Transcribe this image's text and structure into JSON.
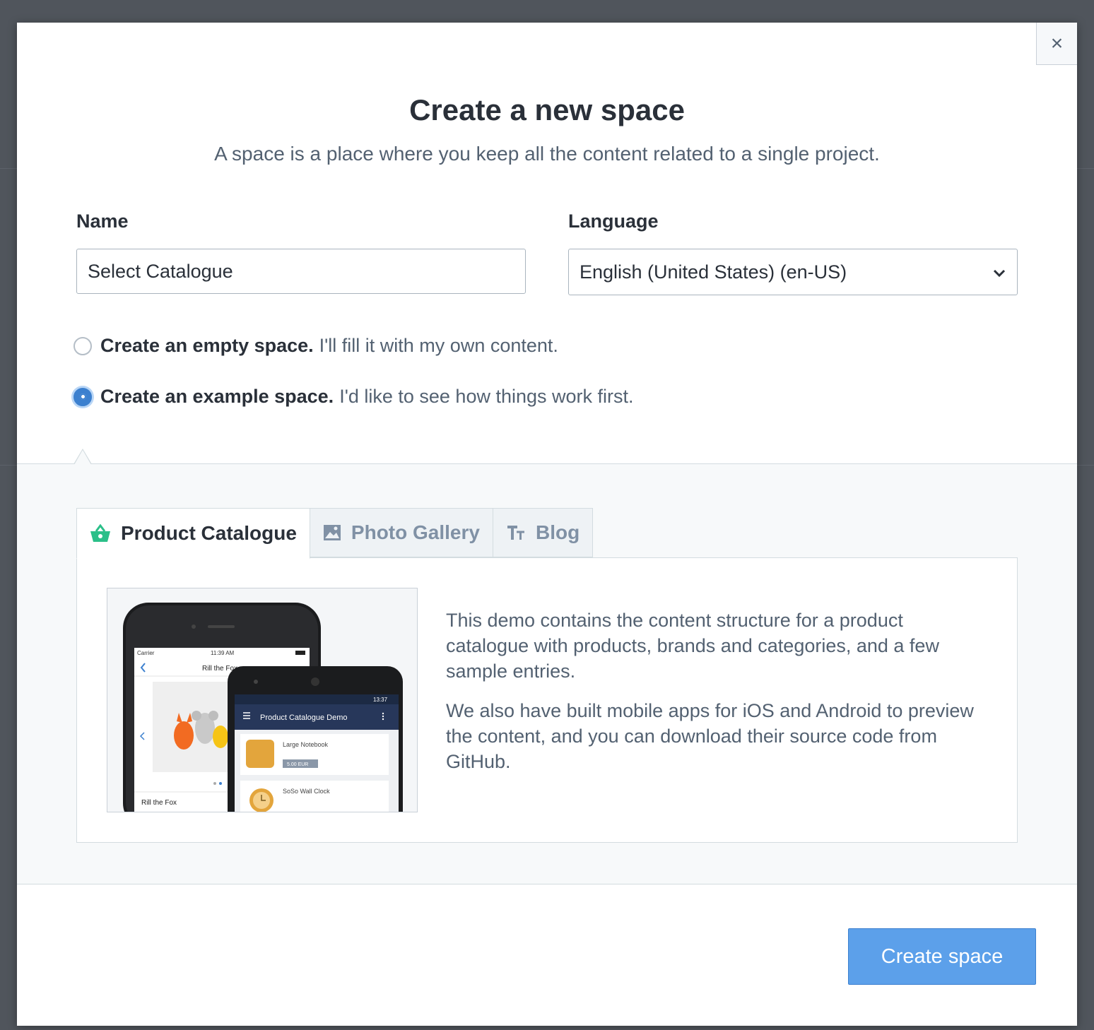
{
  "dialog": {
    "close_symbol": "×",
    "title": "Create a new space",
    "subtitle": "A space is a place where you keep all the content related to a single project."
  },
  "form": {
    "name_label": "Name",
    "name_value": "Select Catalogue",
    "language_label": "Language",
    "language_value": "English (United States) (en-US)"
  },
  "options": [
    {
      "bold": "Create an empty space.",
      "desc": "I'll fill it with my own content.",
      "checked": false
    },
    {
      "bold": "Create an example space.",
      "desc": "I'd like to see how things work first.",
      "checked": true
    }
  ],
  "tabs": [
    {
      "label": "Product Catalogue",
      "icon": "basket-icon",
      "active": true
    },
    {
      "label": "Photo Gallery",
      "icon": "image-icon",
      "active": false
    },
    {
      "label": "Blog",
      "icon": "text-icon",
      "active": false
    }
  ],
  "preview": {
    "ios_carrier": "Carrier",
    "ios_time": "11:39 AM",
    "ios_title": "Rill the Fox",
    "ios_caption": "Rill the Fox",
    "android_time": "13:37",
    "android_title": "Product Catalogue Demo",
    "item1_name": "Large Notebook",
    "item1_price": "5.00 EUR",
    "item2_name": "SoSo Wall Clock"
  },
  "description": {
    "p1": "This demo contains the content structure for a product catalogue with products, brands and categories, and a few sample entries.",
    "p2": "We also have built mobile apps for iOS and Android to preview the content, and you can download their source code from GitHub."
  },
  "footer": {
    "create_label": "Create space"
  },
  "colors": {
    "accent": "#3c80cf",
    "primary_button": "#5ca0ea",
    "basket_icon": "#2bbf89"
  }
}
